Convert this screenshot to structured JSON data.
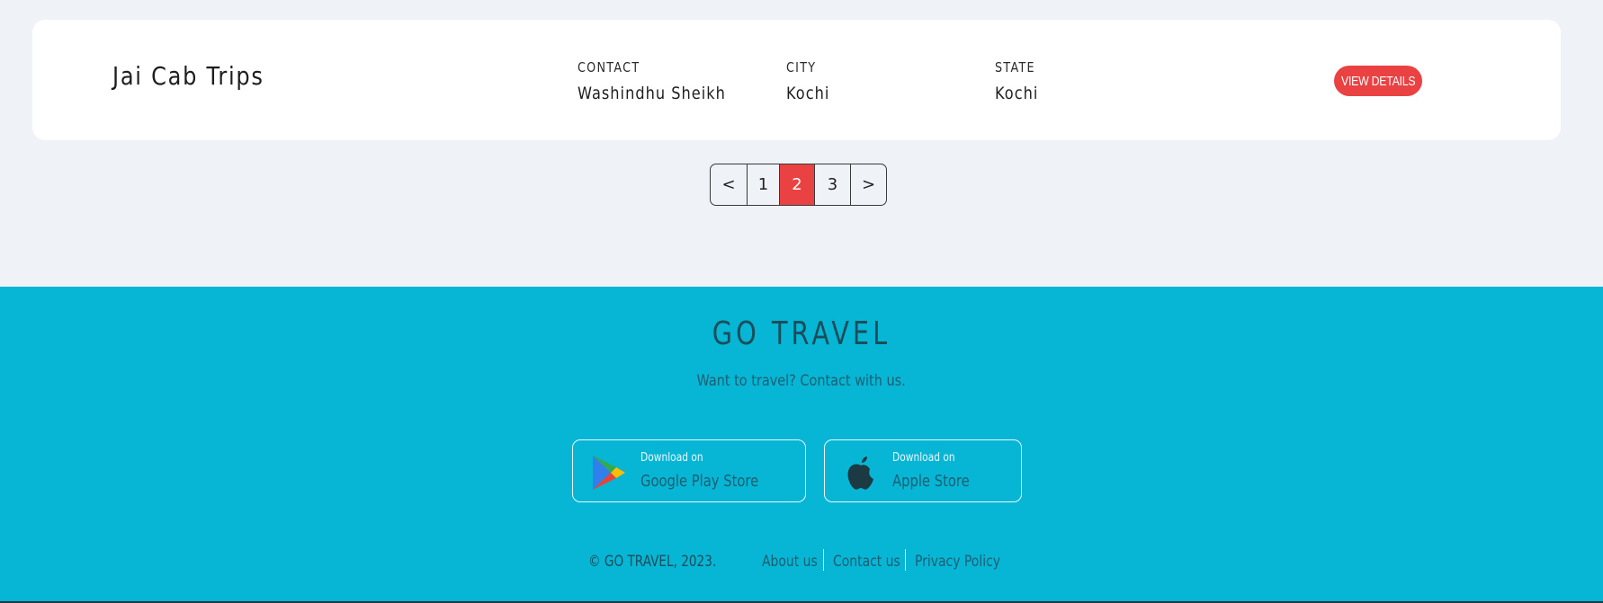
{
  "listing": {
    "company_name": "Jai Cab Trips",
    "contact_label": "CONTACT",
    "contact_value": "Washindhu Sheikh",
    "city_label": "CITY",
    "city_value": "Kochi",
    "state_label": "STATE",
    "state_value": "Kochi",
    "view_details_label": "VIEW DETAILS"
  },
  "pagination": {
    "prev_label": "<",
    "pages": [
      "1",
      "2",
      "3"
    ],
    "current_page": "2",
    "next_label": ">"
  },
  "footer": {
    "brand": "GO TRAVEL",
    "tagline": "Want to travel? Contact with us.",
    "google_play": {
      "small": "Download on",
      "big": "Google Play Store"
    },
    "apple_store": {
      "small": "Download on",
      "big": "Apple Store"
    },
    "copyright": "© GO TRAVEL, 2023.",
    "links": [
      "About us",
      "Contact us",
      "Privacy Policy"
    ]
  },
  "colors": {
    "accent": "#ea4143",
    "footer_bg": "#07b5d5",
    "page_bg": "#eff2f7"
  },
  "icons": {
    "google_play": "google-play-icon",
    "apple": "apple-icon"
  }
}
